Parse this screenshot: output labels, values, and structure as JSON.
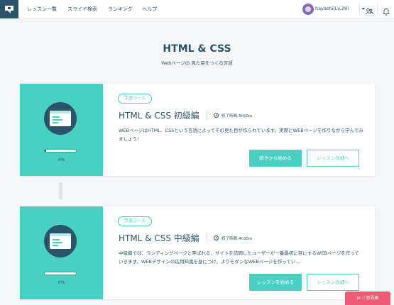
{
  "header": {
    "nav": [
      "レッスン一覧",
      "スライド検索",
      "ランキング",
      "ヘルプ"
    ],
    "user_name": "hayashi(Lv.28)"
  },
  "hero": {
    "title": "HTML & CSS",
    "subtitle": "Webページの 見た目をつくる言語"
  },
  "courses": [
    {
      "badge": "学習コース",
      "title": "HTML & CSS 初級編",
      "duration": "修了時間:3h50m",
      "description": "WEBページはHTML、CSSという言語によってその見た目が作られています。実際にWEBページを作りながら学んでみましょう！",
      "progress_label": "4%",
      "progress": 0.04,
      "primary_button": "続きから始める",
      "secondary_button": "レッスン詳細へ"
    },
    {
      "badge": "学習コース",
      "title": "HTML & CSS 中級編",
      "duration": "修了時間:4h30m",
      "description": "中級編では、ランディングページと呼ばれる、サイトを訪問したユーザーが一番最初に目にするWEBページを作っていきます。WEBデザインの応用知識を身につけ、よりモダンなWEBページを作ってい...",
      "progress_label": "0%",
      "progress": 0.0,
      "primary_button": "レッスンを始める",
      "secondary_button": "レッスン詳細へ"
    }
  ],
  "feedback_label": "✉ ご意見箱",
  "icons": {
    "logo": "progate-logo",
    "users": "users-icon",
    "bell": "bell-icon",
    "clock": "clock-icon",
    "mail": "mail-icon"
  },
  "colors": {
    "accent": "#49d0c2",
    "navy": "#2b546a",
    "feedback": "#ee5a75"
  }
}
